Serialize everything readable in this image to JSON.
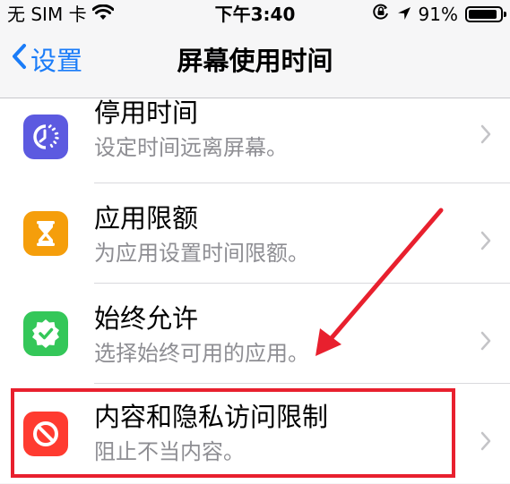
{
  "status_bar": {
    "carrier": "无 SIM 卡",
    "time": "下午3:40",
    "battery": "91%",
    "battery_level": 0.91,
    "icons": [
      "wifi-icon",
      "orientation-lock-icon",
      "location-icon",
      "battery-icon"
    ]
  },
  "nav": {
    "back_label": "设置",
    "title": "屏幕使用时间"
  },
  "items": [
    {
      "title": "停用时间",
      "subtitle": "设定时间远离屏幕。",
      "icon": "downtime-icon",
      "icon_color": "#5c5ae0"
    },
    {
      "title": "应用限额",
      "subtitle": "为应用设置时间限额。",
      "icon": "hourglass-icon",
      "icon_color": "#f59e0b"
    },
    {
      "title": "始终允许",
      "subtitle": "选择始终可用的应用。",
      "icon": "checkmark-badge-icon",
      "icon_color": "#34c759"
    },
    {
      "title": "内容和隐私访问限制",
      "subtitle": "阻止不当内容。",
      "icon": "restriction-icon",
      "icon_color": "#ff3b30"
    }
  ],
  "colors": {
    "accent": "#1a7cf8",
    "annotation": "#e8202e"
  }
}
